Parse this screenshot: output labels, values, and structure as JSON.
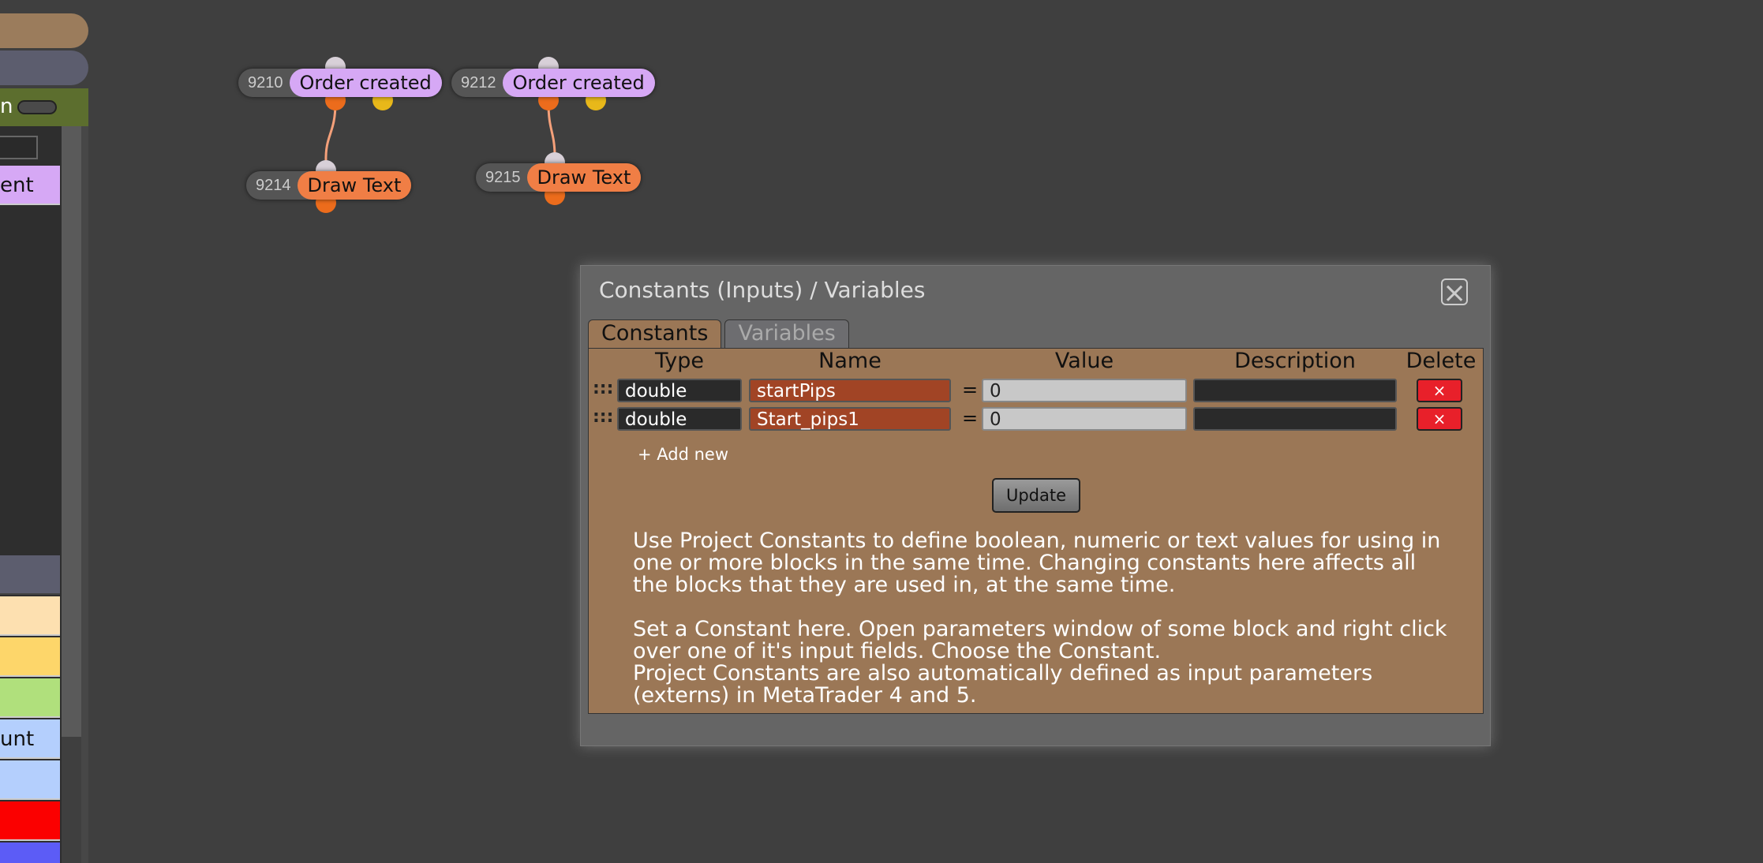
{
  "sidebar": {
    "green_letter": "n",
    "items": [
      {
        "label": "ent",
        "color": "#d6a8f5"
      },
      {
        "label": "",
        "color": "#5c5d6e"
      },
      {
        "label": "",
        "color": "#fde0b0"
      },
      {
        "label": "",
        "color": "#fdd66a"
      },
      {
        "label": "",
        "color": "#b0e07c"
      },
      {
        "label": "unt",
        "color": "#b4cffd"
      },
      {
        "label": "",
        "color": "#b4cffd"
      },
      {
        "label": "",
        "color": "#fb0000"
      },
      {
        "label": "",
        "color": "#5c5cf6"
      }
    ]
  },
  "nodes": [
    {
      "id": "9210",
      "label": "Order created",
      "kind": "purple"
    },
    {
      "id": "9212",
      "label": "Order created",
      "kind": "purple"
    },
    {
      "id": "9214",
      "label": "Draw Text",
      "kind": "orange"
    },
    {
      "id": "9215",
      "label": "Draw Text",
      "kind": "orange"
    }
  ],
  "dialog": {
    "title": "Constants (Inputs) / Variables",
    "close_icon": "×",
    "tabs": [
      {
        "label": "Constants",
        "active": true
      },
      {
        "label": "Variables",
        "active": false
      }
    ],
    "columns": {
      "type": "Type",
      "name": "Name",
      "value": "Value",
      "description": "Description",
      "delete": "Delete"
    },
    "rows": [
      {
        "grip": ":::",
        "type": "double",
        "name": "startPips",
        "equals": "=",
        "value": "0",
        "description": "",
        "delete": "×"
      },
      {
        "grip": ":::",
        "type": "double",
        "name": "Start_pips1",
        "equals": "=",
        "value": "0",
        "description": "",
        "delete": "×"
      }
    ],
    "add_new": "+ Add new",
    "update": "Update",
    "help": [
      "Use Project Constants to define boolean, numeric or text values for using in one or more blocks in the same time. Changing constants here affects all the blocks that they are used in, at the same time.",
      "Set a Constant here. Open parameters window of some block and right click over one of it's input fields. Choose the Constant.",
      "Project Constants are also automatically defined as input parameters (externs) in MetaTrader 4 and 5."
    ]
  }
}
